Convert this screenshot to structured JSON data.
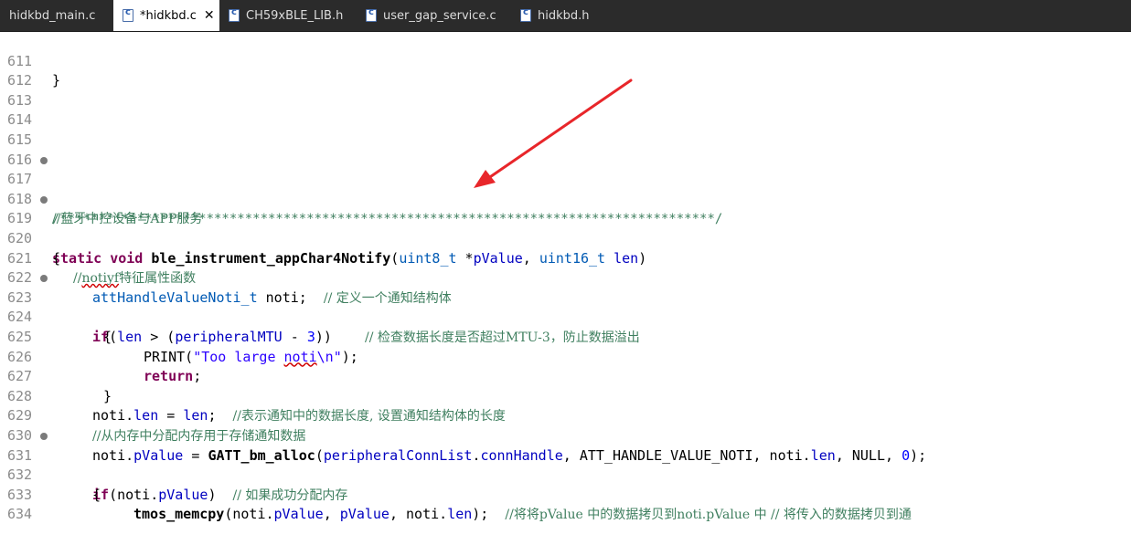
{
  "tabs": [
    {
      "label": "hidkbd_main.c",
      "active": false
    },
    {
      "label": "*hidkbd.c",
      "active": true
    },
    {
      "label": "CH59xBLE_LIB.h",
      "active": false
    },
    {
      "label": "user_gap_service.c",
      "active": false
    },
    {
      "label": "hidkbd.h",
      "active": false
    }
  ],
  "lines": {
    "l611": {
      "num": "611",
      "t1": "}"
    },
    "l612": {
      "num": "612"
    },
    "l613": {
      "num": "613"
    },
    "l614": {
      "num": "614"
    },
    "l615": {
      "num": "615"
    },
    "l616": {
      "num": "616"
    },
    "l617": {
      "num": "617",
      "comment": "//蓝牙中控设备与APP服务"
    },
    "l618": {
      "num": "618",
      "comment": "/*************************************************************************************/"
    },
    "l619": {
      "num": "619",
      "kw1": "static",
      "kw2": "void",
      "fn": "ble_instrument_appChar4Notify",
      "p1": "(",
      "ty1": "uint8_t",
      "p2": " *",
      "v1": "pValue",
      "p3": ", ",
      "ty2": "uint16_t",
      "p4": " ",
      "v2": "len",
      "p5": ")"
    },
    "l620": {
      "num": "620",
      "t1": "{"
    },
    "l621": {
      "num": "621",
      "c1": "//",
      "c2": "notiyf",
      "c3": "特征属性函数"
    },
    "l622": {
      "num": "622",
      "ty1": "attHandleValueNoti_t",
      "t1": " noti;  ",
      "comment": "// 定义一个通知结构体"
    },
    "l623": {
      "num": "623",
      "kw1": "if",
      "t1": "(",
      "v1": "len",
      "t2": " > (",
      "v2": "peripheralMTU",
      "t3": " - ",
      "n1": "3",
      "t4": "))   ",
      "comment": "// 检查数据长度是否超过MTU-3，防止数据溢出"
    },
    "l624": {
      "num": "624",
      "t1": "{"
    },
    "l625": {
      "num": "625",
      "t1": "PRINT(",
      "s1": "\"Too large ",
      "s2": "noti",
      "s3": "\\n\"",
      "t2": ");"
    },
    "l626": {
      "num": "626",
      "kw1": "return",
      "t1": ";"
    },
    "l627": {
      "num": "627",
      "t1": "}"
    },
    "l628": {
      "num": "628",
      "t1": "noti.",
      "v1": "len",
      "t2": " = ",
      "v3": "len",
      "t3": ";  ",
      "comment": "//表示通知中的数据长度, 设置通知结构体的长度"
    },
    "l629": {
      "num": "629",
      "comment": "//从内存中分配内存用于存储通知数据"
    },
    "l630": {
      "num": "630",
      "t1": "noti.",
      "v1": "pValue",
      "t2": " = ",
      "fn": "GATT_bm_alloc",
      "t3": "(",
      "v2": "peripheralConnList",
      "t4": ".",
      "v3": "connHandle",
      "t5": ", ATT_HANDLE_VALUE_NOTI, noti.",
      "v4": "len",
      "t6": ", NULL, ",
      "n1": "0",
      "t7": ");"
    },
    "l631": {
      "num": "631",
      "kw1": "if",
      "t1": "(noti.",
      "v1": "pValue",
      "t2": ")  ",
      "comment": "// 如果成功分配内存"
    },
    "l632": {
      "num": "632",
      "t1": "{"
    },
    "l633": {
      "num": "633",
      "fn": "tmos_memcpy",
      "t1": "(noti.",
      "v1": "pValue",
      "t2": ", ",
      "v2": "pValue",
      "t3": ", noti.",
      "v3": "len",
      "t4": ");  ",
      "comment": "//将将pValue 中的数据拷贝到noti.pValue 中 // 将传入的数据拷贝到通"
    },
    "l634": {
      "num": "634"
    }
  },
  "colors": {
    "keyword": "#7f0055",
    "comment": "#3f7f5f",
    "type": "#005ab4",
    "variable": "#0000c0",
    "string": "#2a00ff",
    "annotation_arrow": "#e8262a"
  }
}
